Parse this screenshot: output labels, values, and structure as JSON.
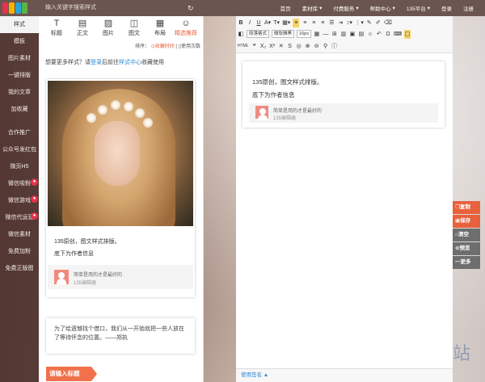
{
  "header": {
    "search_placeholder": "输入关键字搜索样式",
    "nav": [
      {
        "label": "首页",
        "badge": ""
      },
      {
        "label": "素材库",
        "badge": ""
      },
      {
        "label": "付费服务",
        "badge": ""
      },
      {
        "label": "帮助中心",
        "badge": ""
      },
      {
        "label": "135平台",
        "badge": ""
      },
      {
        "label": "登录",
        "badge": ""
      },
      {
        "label": "注册",
        "badge": ""
      }
    ],
    "logo_colors": [
      "#e5334b",
      "#f5b400",
      "#28a4d9",
      "#5ab546"
    ]
  },
  "sidebar": {
    "items": [
      {
        "label": "样式"
      },
      {
        "label": "模板"
      },
      {
        "label": "图片素材"
      },
      {
        "label": "一键排版"
      },
      {
        "label": "我的文章"
      },
      {
        "label": "加收藏"
      },
      {
        "label": "合作推广"
      },
      {
        "label": "公众号发红包"
      },
      {
        "label": "微页H5"
      },
      {
        "label": "微信吸粉"
      },
      {
        "label": "微信游戏"
      },
      {
        "label": "微信代运营"
      },
      {
        "label": "微信素材"
      },
      {
        "label": "免费加粉"
      },
      {
        "label": "免费正版图"
      }
    ]
  },
  "panel": {
    "tabs": [
      {
        "label": "标题",
        "icon": "T"
      },
      {
        "label": "正文",
        "icon": "▤"
      },
      {
        "label": "图片",
        "icon": "▨"
      },
      {
        "label": "图文",
        "icon": "◫"
      },
      {
        "label": "布局",
        "icon": "▦"
      },
      {
        "label": "精选推荐",
        "icon": "☺"
      }
    ],
    "sort_label": "排序：",
    "sort_favorite": "收藏时间",
    "sort_used": "使用次数",
    "notice_prefix": "想要更多样式？请",
    "notice_login": "登录",
    "notice_mid": "后前往",
    "notice_center": "样式中心",
    "notice_suffix": "收藏使用",
    "card_line1": "135原创，图文样式排版。",
    "card_line2": "底下为作者信息",
    "author_name": "简单是用的才是最好的",
    "author_sub": "135编辑器",
    "quote": "为了给遗憾找个借口，我们从一开始就把一些人放在了等待怀念的位置。——郑执",
    "title_button": "请输入标题"
  },
  "editor": {
    "font_family": "微软雅黑",
    "font_size": "16px",
    "para": "段落格式",
    "line1": "135原创，图文样式排版。",
    "line2": "底下为作者信息",
    "author_name": "简单是用的才是最好的",
    "author_sub": "135编辑器",
    "status": "使用签名 ▲"
  },
  "actions": [
    {
      "label": "复制",
      "color": "#e8603c"
    },
    {
      "label": "保存",
      "color": "#e8603c"
    },
    {
      "label": "清空",
      "color": "#6e6e6e"
    },
    {
      "label": "预览",
      "color": "#6e6e6e"
    },
    {
      "label": "更多",
      "color": "#6e6e6e"
    }
  ],
  "watermark": "站"
}
